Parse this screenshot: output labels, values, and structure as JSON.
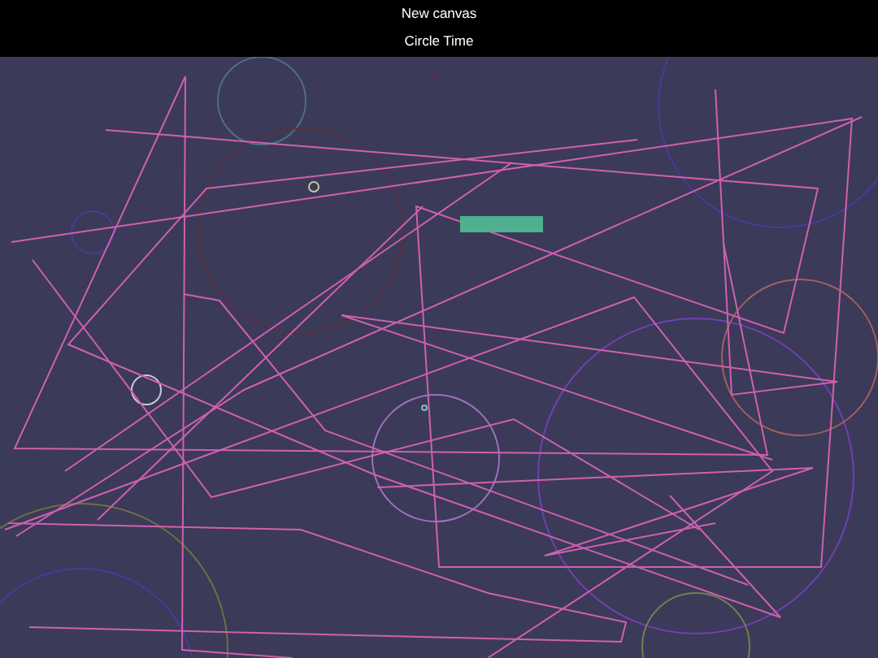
{
  "header": {
    "button": "New canvas",
    "title": "Circle Time"
  }
}
